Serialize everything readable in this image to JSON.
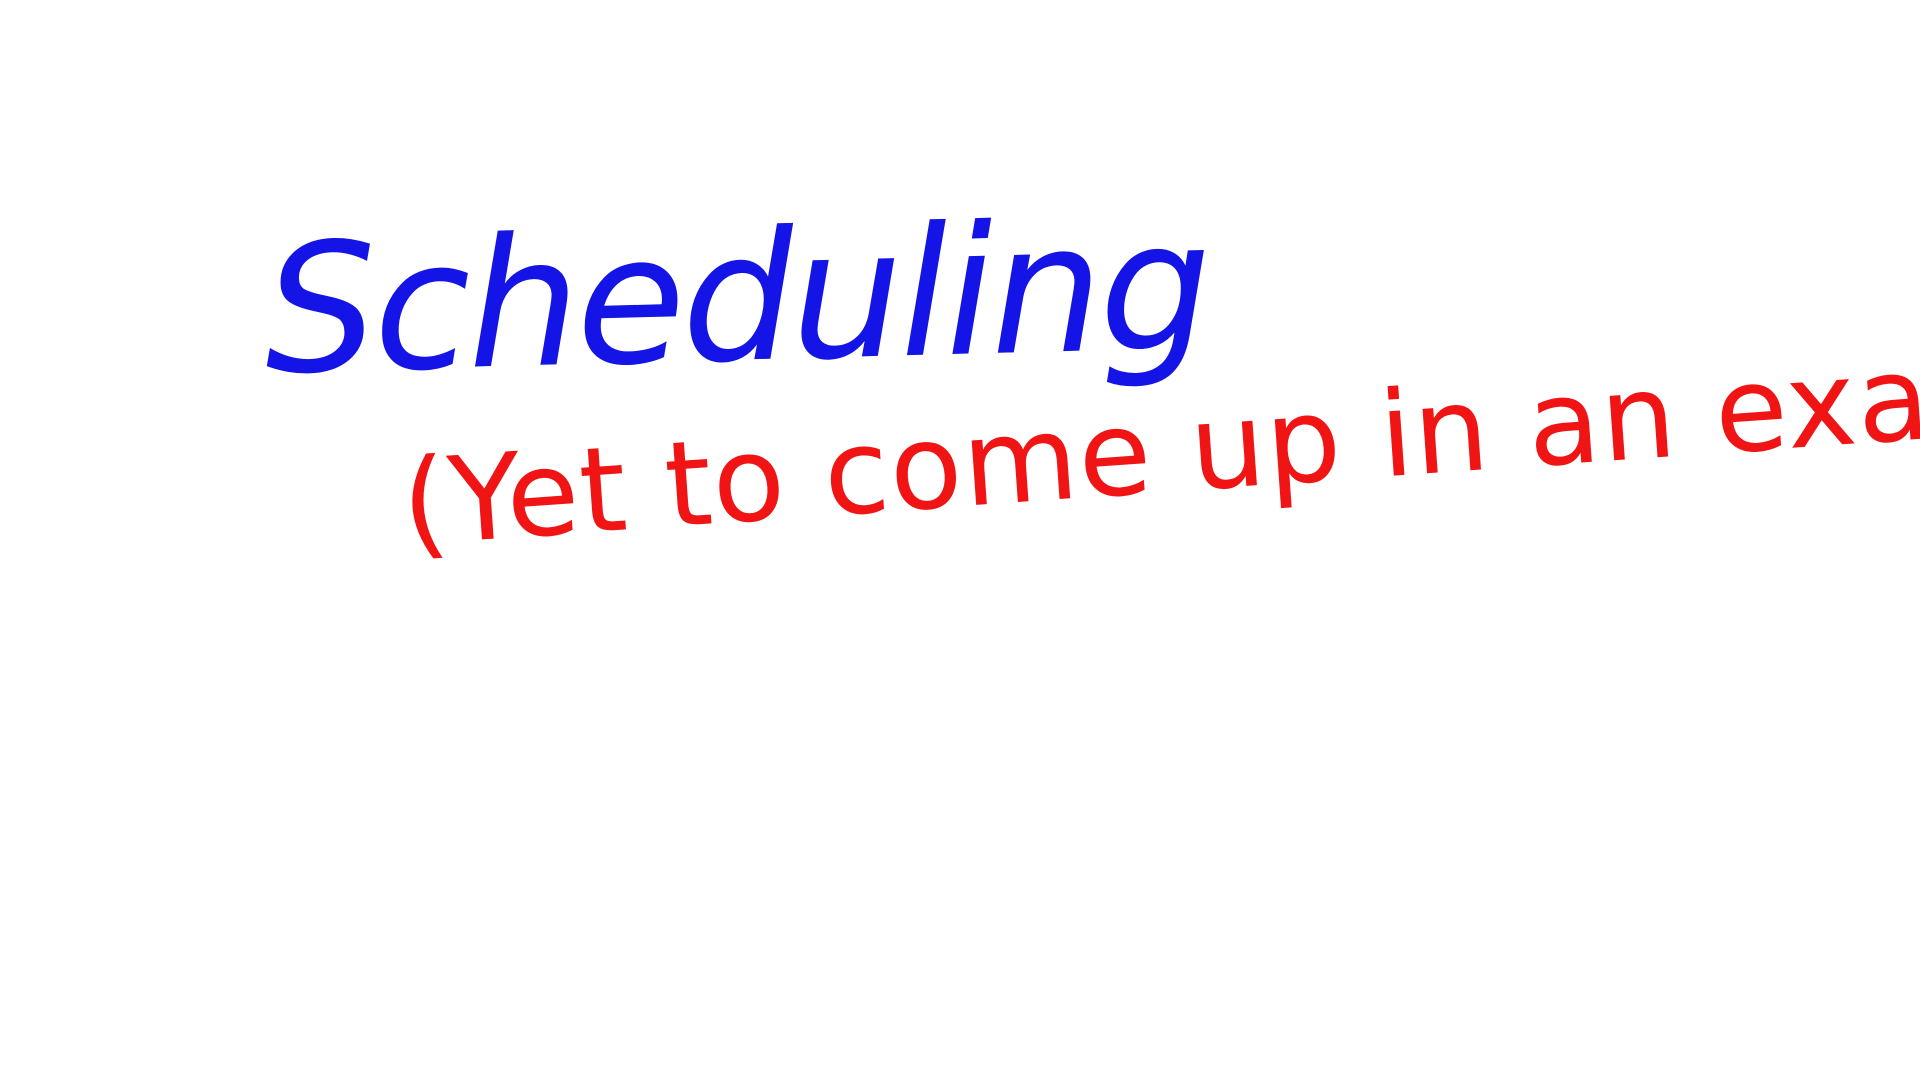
{
  "whiteboard": {
    "heading": "Scheduling",
    "note": "(Yet to come up in an exam)"
  },
  "colors": {
    "heading_ink": "#1414e6",
    "note_ink": "#f01414",
    "background": "#ffffff"
  }
}
